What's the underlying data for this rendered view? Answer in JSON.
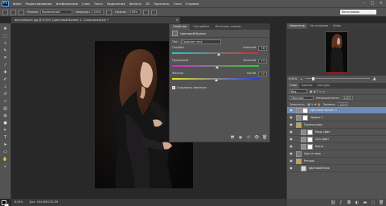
{
  "menu": {
    "logo": "Ps",
    "items": [
      "Файл",
      "Редактирование",
      "Изображение",
      "Слои",
      "Текст",
      "Выделение",
      "Фильтр",
      "3D",
      "Просмотр",
      "Окно",
      "Справка"
    ]
  },
  "options": {
    "mode_label": "Режим:",
    "mode_value": "Нормальный",
    "opacity_label": "Непрозр.:",
    "opacity_value": "100%",
    "flow_label": "Нажим:",
    "flow_value": "100%"
  },
  "workspace": "Фотография",
  "document": {
    "tab_title": "dianyidijad-8.jpg @ 6,54% (Цветовой баланс 1, Слой-маска/16) *",
    "close": "×",
    "zoom": "6,54%",
    "doc_info": "Док: 164,6М/235,2М"
  },
  "properties": {
    "tabs": [
      "Свойства",
      "Настройки",
      "Источник клонов"
    ],
    "active_tab": 0,
    "title": "Цветовой баланс",
    "tone_label": "Тон:",
    "tone_value": "Средние тона",
    "sliders": [
      {
        "left": "Голубая",
        "right": "Красный",
        "value": "+8",
        "position": 0.54,
        "gradient": [
          "#23c8d6",
          "#d62828"
        ]
      },
      {
        "left": "Пурпурный",
        "right": "Зеленый",
        "value": "+3",
        "position": 0.52,
        "gradient": [
          "#d42ad4",
          "#2ad42a"
        ]
      },
      {
        "left": "Желтая",
        "right": "Синий",
        "value": "+2",
        "position": 0.51,
        "gradient": [
          "#e4e42a",
          "#2a3ae4"
        ]
      }
    ],
    "preserve_label": "Сохранить свечение",
    "preserve_checked": true,
    "footer_icons": [
      "clip-to-layer-icon",
      "view-previous-icon",
      "reset-icon",
      "visibility-icon",
      "delete-icon"
    ]
  },
  "navigator": {
    "tabs": [
      "Навигатор",
      "Гистограмма",
      "Инфо"
    ],
    "zoom": "6,54%"
  },
  "layers": {
    "tabs": [
      "Слои",
      "Каналы",
      "Контуры"
    ],
    "kind_label": "Вид",
    "blend_value": "Обычные",
    "opacity_label": "Непрозрачность:",
    "opacity_value": "100%",
    "lock_label": "Закрепить:",
    "fill_label": "Заливка:",
    "fill_value": "100%",
    "items": [
      {
        "name": "Цветовой баланс 1",
        "thumb": "#8a8a8a",
        "selected": true,
        "mask": true,
        "indent": 0
      },
      {
        "name": "Уровни 1",
        "thumb": "#8a8a8a",
        "selected": false,
        "mask": true,
        "indent": 0
      },
      {
        "name": "Группа кожи",
        "thumb": "#c9a050",
        "selected": false,
        "mask": false,
        "indent": 0
      },
      {
        "name": "Разд. Цвет",
        "thumb": "#8a8a8a",
        "selected": false,
        "mask": true,
        "indent": 6
      },
      {
        "name": "Сел. Цвет",
        "thumb": "#8a8a8a",
        "selected": false,
        "mask": true,
        "indent": 6
      },
      {
        "name": "Кисть",
        "thumb": "#8a8a8a",
        "selected": false,
        "mask": true,
        "indent": 6
      },
      {
        "name": "Свет и тени",
        "thumb": "#777777",
        "selected": false,
        "mask": false,
        "indent": 0
      },
      {
        "name": "Ретушь",
        "thumb": "#c9a050",
        "selected": false,
        "mask": false,
        "indent": 0
      },
      {
        "name": "Цветовой блок",
        "thumb": "#d8d8d8",
        "selected": false,
        "mask": false,
        "indent": 6
      }
    ],
    "footer_icons": [
      "link-icon",
      "fx-icon",
      "mask-icon",
      "adjustment-icon",
      "folder-icon",
      "new-layer-icon",
      "trash-icon"
    ]
  },
  "colors": {
    "panel": "#535353",
    "dark": "#282828",
    "selected": "#6e8bb5",
    "navigator_frame": "#c02020"
  }
}
